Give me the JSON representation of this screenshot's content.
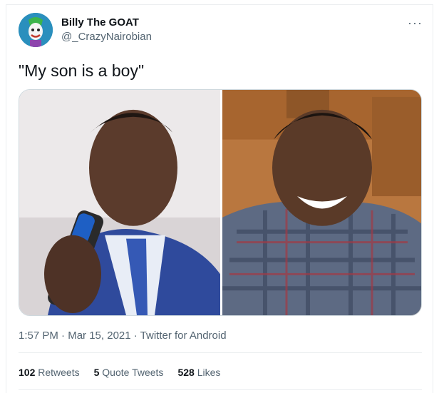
{
  "user": {
    "display_name": "Billy The GOAT",
    "handle": "@_CrazyNairobian"
  },
  "tweet": {
    "text": "\"My son is a boy\""
  },
  "meta": {
    "time": "1:57 PM",
    "sep1": " · ",
    "date": "Mar 15, 2021",
    "sep2": " · ",
    "source": "Twitter for Android"
  },
  "stats": {
    "retweets_count": "102",
    "retweets_label": "Retweets",
    "quotes_count": "5",
    "quotes_label": "Quote Tweets",
    "likes_count": "528",
    "likes_label": "Likes"
  },
  "icons": {
    "more": "more-horizontal-icon"
  },
  "colors": {
    "text": "#0f1419",
    "secondary": "#536471",
    "border": "#ebeef0"
  }
}
